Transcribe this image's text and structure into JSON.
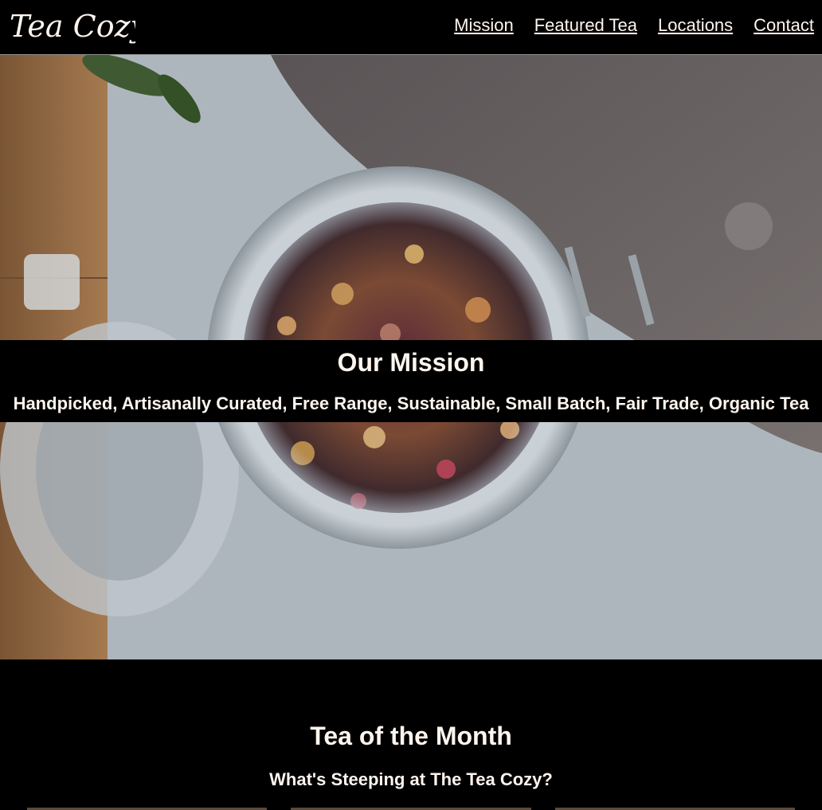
{
  "header": {
    "logo_text": "Tea Cozy",
    "nav": [
      {
        "label": "Mission"
      },
      {
        "label": "Featured Tea"
      },
      {
        "label": "Locations"
      },
      {
        "label": "Contact"
      }
    ]
  },
  "hero": {
    "image": "jar of loose leaf tea on table"
  },
  "mission": {
    "title": "Our Mission",
    "subtitle": "Handpicked, Artisanally Curated, Free Range, Sustainable, Small Batch, Fair Trade, Organic Tea"
  },
  "tea_of_month": {
    "title": "Tea of the Month",
    "subtitle": "What's Steeping at The Tea Cozy?"
  },
  "colors": {
    "background": "#000000",
    "text": "#fff5ee",
    "hero_table": "#aeb6bd"
  }
}
